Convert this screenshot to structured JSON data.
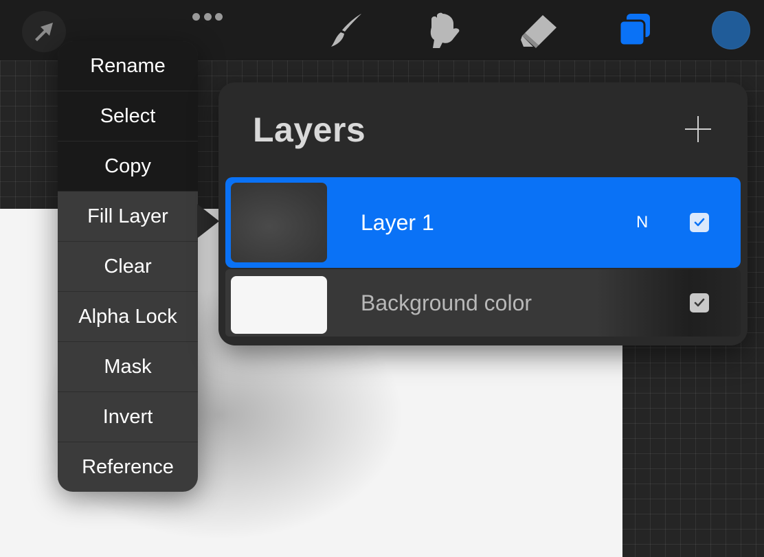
{
  "app": {
    "accent_color": "#0a72f6",
    "brush_color": "#205c99"
  },
  "toolbar": {
    "icons": [
      "arrow-icon",
      "more-icon",
      "brush-icon",
      "smudge-icon",
      "eraser-icon",
      "layers-icon",
      "color-icon"
    ]
  },
  "menu": {
    "items": [
      "Rename",
      "Select",
      "Copy",
      "Fill Layer",
      "Clear",
      "Alpha Lock",
      "Mask",
      "Invert",
      "Reference"
    ]
  },
  "layers_panel": {
    "title": "Layers",
    "layers": [
      {
        "name": "Layer 1",
        "blend_mode": "N",
        "visible": true,
        "selected": true
      },
      {
        "name": "Background color",
        "visible": true,
        "selected": false
      }
    ]
  }
}
